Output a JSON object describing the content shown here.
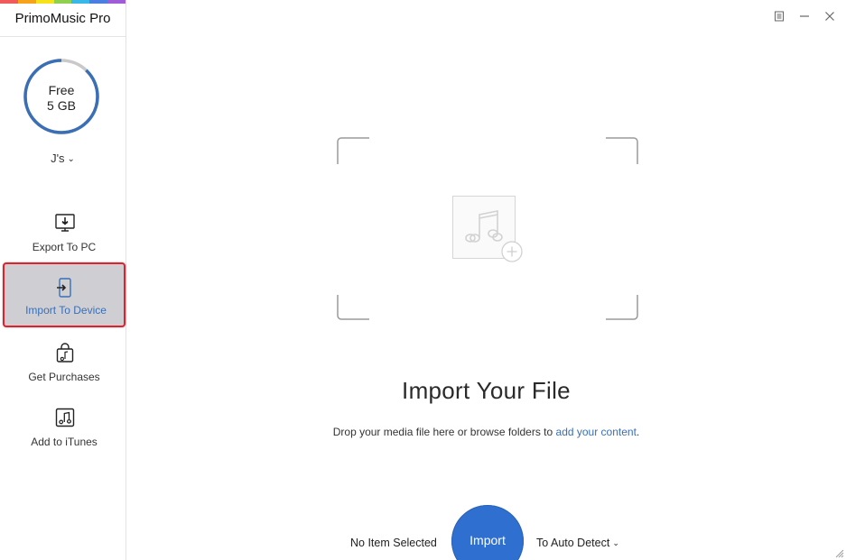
{
  "app": {
    "title": "PrimoMusic Pro",
    "brand_colors": [
      "#f15a5a",
      "#f7a21b",
      "#f6e21b",
      "#8fd14f",
      "#39b7e8",
      "#4a7ee0",
      "#a05cd6"
    ]
  },
  "window_controls": {
    "menu_icon": "menu-icon",
    "minimize_icon": "minimize-icon",
    "close_icon": "close-icon"
  },
  "storage": {
    "line1": "Free",
    "line2": "5 GB",
    "ring_color": "#3a6fb6",
    "ring_track_color": "#c9c9c9",
    "used_fraction": 0.12
  },
  "device": {
    "name": "J's",
    "chevron_icon": "chevron-down-icon"
  },
  "nav": [
    {
      "id": "export",
      "label": "Export To PC",
      "icon": "export-to-pc-icon",
      "active": false
    },
    {
      "id": "import",
      "label": "Import To Device",
      "icon": "import-to-device-icon",
      "active": true
    },
    {
      "id": "purchases",
      "label": "Get Purchases",
      "icon": "shopping-bag-icon",
      "active": false
    },
    {
      "id": "itunes",
      "label": "Add to iTunes",
      "icon": "itunes-note-icon",
      "active": false
    }
  ],
  "main": {
    "heading": "Import Your File",
    "hint_prefix": "Drop your media file here or browse folders to ",
    "hint_link": "add your content",
    "hint_suffix": ".",
    "drop_icon": "music-note-icon",
    "add_icon": "plus-circle-icon"
  },
  "footer": {
    "selection_status": "No Item Selected",
    "import_label": "Import",
    "target_label": "To Auto Detect",
    "accent_color": "#2f6fd0"
  }
}
